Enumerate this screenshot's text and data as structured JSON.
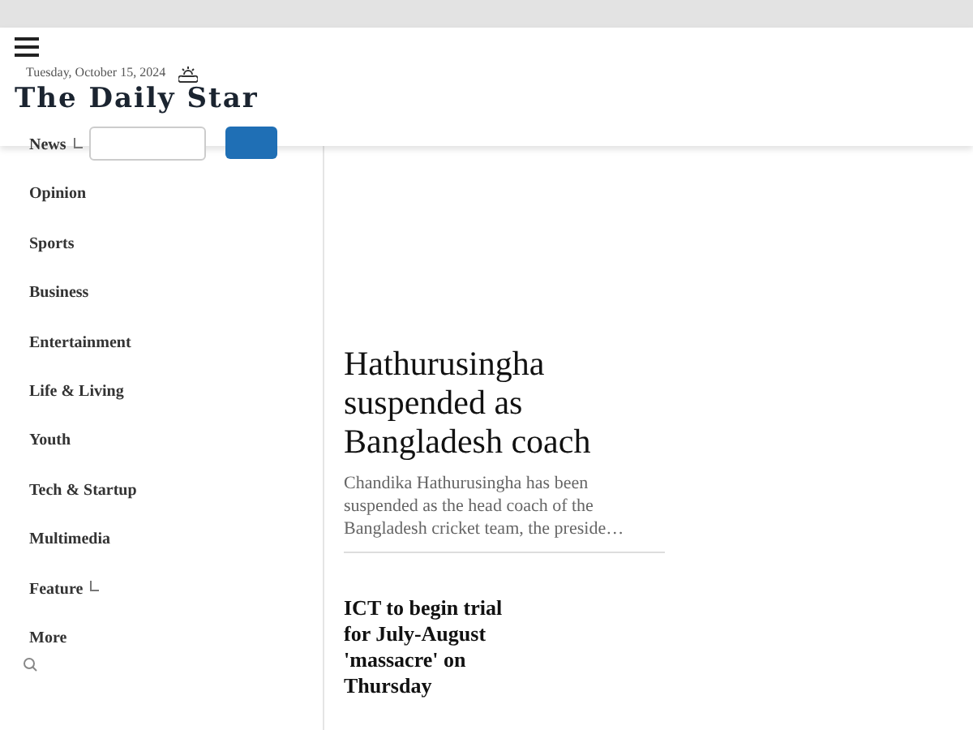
{
  "header": {
    "date": "Tuesday, October 15, 2024",
    "logo": "The Daily Star"
  },
  "nav": {
    "items": [
      {
        "label": "News",
        "submenu": true
      },
      {
        "label": "Opinion",
        "submenu": false
      },
      {
        "label": "Sports",
        "submenu": false
      },
      {
        "label": "Business",
        "submenu": false
      },
      {
        "label": "Entertainment",
        "submenu": false
      },
      {
        "label": "Life & Living",
        "submenu": false
      },
      {
        "label": "Youth",
        "submenu": false
      },
      {
        "label": "Tech & Startup",
        "submenu": false
      },
      {
        "label": "Multimedia",
        "submenu": false
      },
      {
        "label": "Feature",
        "submenu": true
      },
      {
        "label": "More",
        "submenu": false
      }
    ]
  },
  "articles": [
    {
      "kind": "lead",
      "title": "Hathurusingha suspended as Bangladesh coach",
      "summary": "Chandika Hathurusingha has been suspended as the head coach of the Bangladesh cricket team, the preside…"
    },
    {
      "kind": "small",
      "title": "ICT to begin trial for July-August 'massacre' on Thursday"
    }
  ]
}
